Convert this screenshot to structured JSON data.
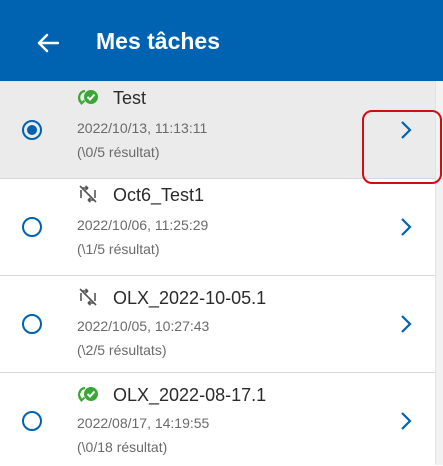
{
  "header": {
    "title": "Mes tâches",
    "background_color": "#0063b1",
    "back_icon": "arrow-left-icon"
  },
  "tasks": [
    {
      "name": "Test",
      "date": "2022/10/13, 11:13:11",
      "result": "(\\0/5 résultat)",
      "selected": true,
      "status_icon": "sync-ok-icon"
    },
    {
      "name": "Oct6_Test1",
      "date": "2022/10/06, 11:25:29",
      "result": "(\\1/5 résultat)",
      "selected": false,
      "status_icon": "sync-disabled-icon"
    },
    {
      "name": "OLX_2022-10-05.1",
      "date": "2022/10/05, 10:27:43",
      "result": "(\\2/5 résultats)",
      "selected": false,
      "status_icon": "sync-disabled-icon"
    },
    {
      "name": "OLX_2022-08-17.1",
      "date": "2022/08/17, 14:19:55",
      "result": "(\\0/18 résultat)",
      "selected": false,
      "status_icon": "sync-ok-icon"
    }
  ],
  "colors": {
    "accent": "#0063b1",
    "sync_ok_green": "#3aa635",
    "highlight_red": "#d10d14",
    "selected_row": "#ebebeb"
  }
}
